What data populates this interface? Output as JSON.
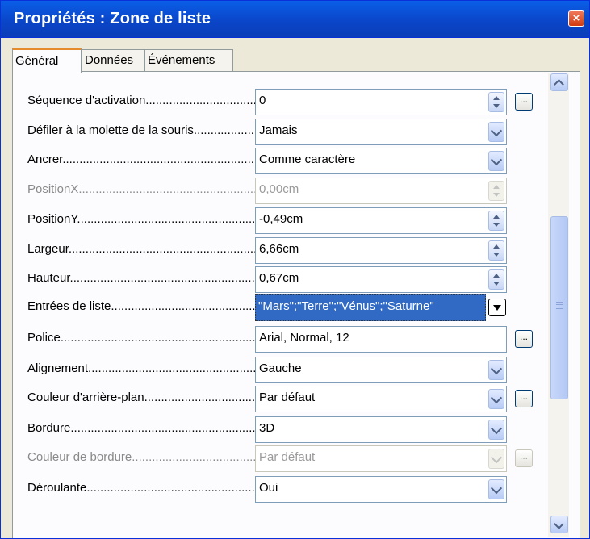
{
  "window": {
    "title": "Propriétés : Zone de liste",
    "close_label": "×"
  },
  "tabs": [
    {
      "label": "Général",
      "active": true
    },
    {
      "label": "Données",
      "active": false
    },
    {
      "label": "Événements",
      "active": false
    }
  ],
  "rows": [
    {
      "label": "Séquence d'activation.............................................",
      "value": "0",
      "control": "spin",
      "ellipsis": true,
      "disabled": false
    },
    {
      "label": "Défiler à la molette de la souris....................................",
      "value": "Jamais",
      "control": "dropdown",
      "ellipsis": false,
      "disabled": false
    },
    {
      "label": "Ancrer..............................................................",
      "value": "Comme caractère",
      "control": "dropdown",
      "ellipsis": false,
      "disabled": false
    },
    {
      "label": "PositionX...........................................................",
      "value": "0,00cm",
      "control": "spin",
      "ellipsis": false,
      "disabled": true
    },
    {
      "label": "PositionY...........................................................",
      "value": "-0,49cm",
      "control": "spin",
      "ellipsis": false,
      "disabled": false
    },
    {
      "label": "Largeur.............................................................",
      "value": "6,66cm",
      "control": "spin",
      "ellipsis": false,
      "disabled": false
    },
    {
      "label": "Hauteur.............................................................",
      "value": "0,67cm",
      "control": "spin",
      "ellipsis": false,
      "disabled": false
    },
    {
      "label": "Entrées de liste....................................................",
      "value": "\"Mars\";\"Terre\";\"Vénus\";\"Saturne\"",
      "control": "list",
      "ellipsis": false,
      "disabled": false
    },
    {
      "label": "Police..............................................................",
      "value": "Arial, Normal, 12",
      "control": "none",
      "ellipsis": true,
      "disabled": false
    },
    {
      "label": "Alignement..........................................................",
      "value": "Gauche",
      "control": "dropdown",
      "ellipsis": false,
      "disabled": false
    },
    {
      "label": "Couleur d'arrière-plan..............................................",
      "value": "Par défaut",
      "control": "dropdown",
      "ellipsis": true,
      "disabled": false
    },
    {
      "label": "Bordure.............................................................",
      "value": "3D",
      "control": "dropdown",
      "ellipsis": false,
      "disabled": false
    },
    {
      "label": "Couleur de bordure..................................................",
      "value": "Par défaut",
      "control": "dropdown",
      "ellipsis": true,
      "disabled": true
    },
    {
      "label": "Déroulante..........................................................",
      "value": "Oui",
      "control": "dropdown",
      "ellipsis": false,
      "disabled": false
    }
  ],
  "ellipsis_label": "...",
  "scrollbar": {
    "position": 0.36,
    "visible_fraction": 0.52
  }
}
